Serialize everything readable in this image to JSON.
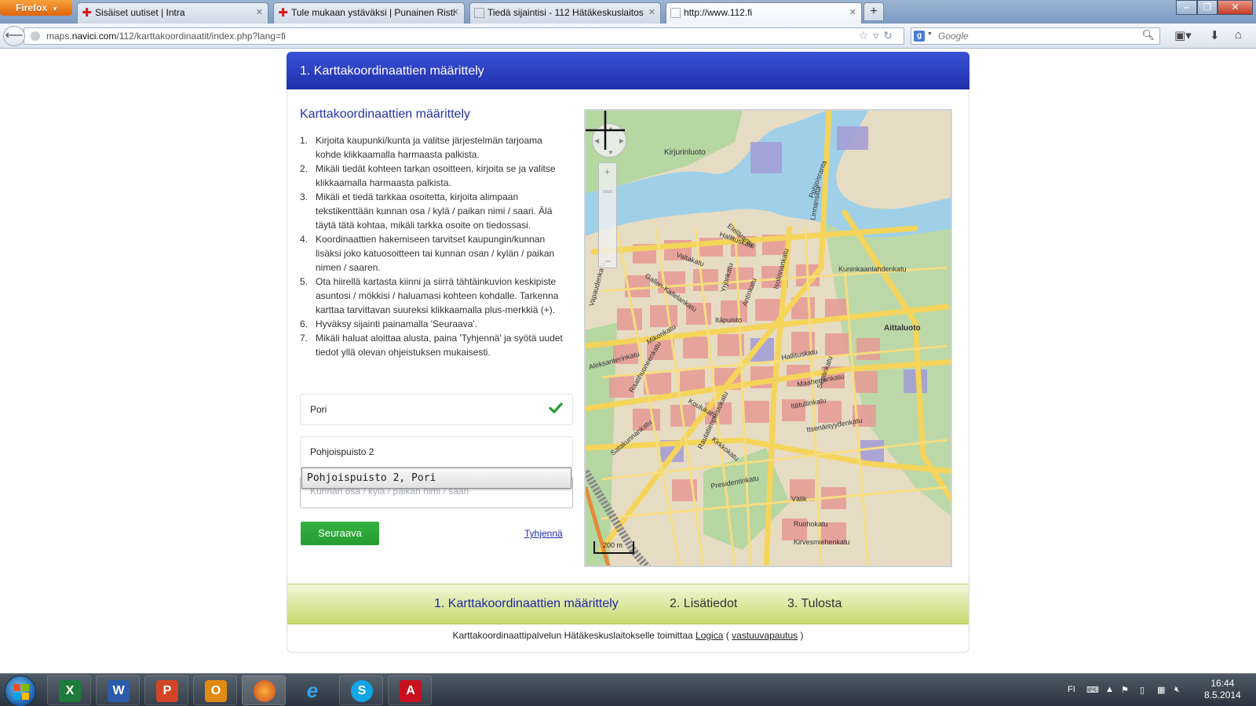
{
  "browser": {
    "app_button": "Firefox",
    "tabs": [
      {
        "title": "Sisäiset uutiset | Intra",
        "icon": "red-cross-icon"
      },
      {
        "title": "Tule mukaan ystäväksi | Punainen Risti",
        "icon": "red-cross-icon"
      },
      {
        "title": "Tiedä sijaintisi - 112 Hätäkeskuslaitos",
        "icon": "blank-page-icon"
      },
      {
        "title": "http://www.112.fi",
        "icon": "blank-page-icon",
        "active": true
      }
    ],
    "url_host_prefix": "maps.",
    "url_host": "navici.com",
    "url_path": "/112/karttakoordinaatit/index.php?lang=fi",
    "search_placeholder": "Google"
  },
  "page": {
    "header_title": "1. Karttakoordinaattien määrittely",
    "section_title": "Karttakoordinaattien määrittely",
    "instructions": [
      {
        "num": "1.",
        "text": "Kirjoita kaupunki/kunta ja valitse järjestelmän tarjoama kohde klikkaamalla harmaasta palkista."
      },
      {
        "num": "2.",
        "text": "Mikäli tiedät kohteen tarkan osoitteen, kirjoita se ja valitse klikkaamalla harmaasta palkista."
      },
      {
        "num": "3.",
        "text": "Mikäli et tiedä tarkkaa osoitetta, kirjoita alimpaan tekstikenttään kunnan osa / kylä / paikan nimi / saari. Älä täytä tätä kohtaa, mikäli tarkka osoite on tiedossasi."
      },
      {
        "num": "4.",
        "text": "Koordinaattien hakemiseen tarvitset kaupungin/kunnan lisäksi joko katuosoitteen tai kunnan osan / kylän / paikan nimen / saaren."
      },
      {
        "num": "5.",
        "text": "Ota hiirellä kartasta kiinni ja siirrä tähtäinkuvion keskipiste asuntosi / mökkisi / haluamasi kohteen kohdalle. Tarkenna karttaa tarvittavan suureksi klikkaamalla plus-merkkiä (+)."
      },
      {
        "num": "6.",
        "text": "Hyväksy sijainti painamalla 'Seuraava'."
      },
      {
        "num": "7.",
        "text": "Mikäli haluat aloittaa alusta, paina 'Tyhjennä' ja syötä uudet tiedot yllä olevan ohjeistuksen mukaisesti."
      }
    ],
    "city_value": "Pori",
    "address_value": "Pohjoispuisto 2",
    "autocomplete_suggestion": "Pohjoispuisto 2, Pori",
    "area_placeholder": "Kunnan osa / kylä / paikan nimi / saari",
    "next_button": "Seuraava",
    "clear_link": "Tyhjennä",
    "accent_color": "#2533a4",
    "button_color": "#2ea83a"
  },
  "map": {
    "scale_label": "200 m",
    "labels": [
      "Kirjurinluoto",
      "Linnansilta",
      "Pohjoisranta",
      "Hallituskatu",
      "Valtakatu",
      "Gallen-Kallelankatu",
      "Aittaluoto",
      "Kuninkaanlahdenkatu",
      "Itäpuisto",
      "Antinkatu",
      "Yrjönkatu",
      "Isolinnankatu",
      "Hallituskatu",
      "Maaherrankatu",
      "Itätullinkatu",
      "Itsenäisyydenkatu",
      "Koulukatu",
      "Rautatienpuistokatu",
      "Presidentinkatu",
      "Kirkkokatu",
      "Mikonkatu",
      "Satakunnankatu",
      "Aleksanterinkatu",
      "Eteläranta",
      "Raatihuoneenkatu",
      "Sepänkatu",
      "Vapaudenkatu",
      "Ruohokatu",
      "Kirvesmiehenkatu",
      "Välik"
    ]
  },
  "wizard": {
    "steps": [
      {
        "label": "1. Karttakoordinaattien määrittely",
        "active": true
      },
      {
        "label": "2. Lisätiedot",
        "active": false
      },
      {
        "label": "3. Tulosta",
        "active": false
      }
    ]
  },
  "footer": {
    "text_before": "Karttakoordinaattipalvelun Hätäkeskuslaitokselle toimittaa",
    "provider_link": "Logica",
    "text_paren_open": "(",
    "disclaimer_link": "vastuuvapautus",
    "text_paren_close": ")"
  },
  "taskbar": {
    "apps": [
      "excel-icon",
      "word-icon",
      "powerpoint-icon",
      "outlook-icon",
      "firefox-icon",
      "internet-explorer-icon",
      "skype-icon",
      "acrobat-icon"
    ],
    "language": "FI",
    "time": "16:44",
    "date": "8.5.2014"
  }
}
